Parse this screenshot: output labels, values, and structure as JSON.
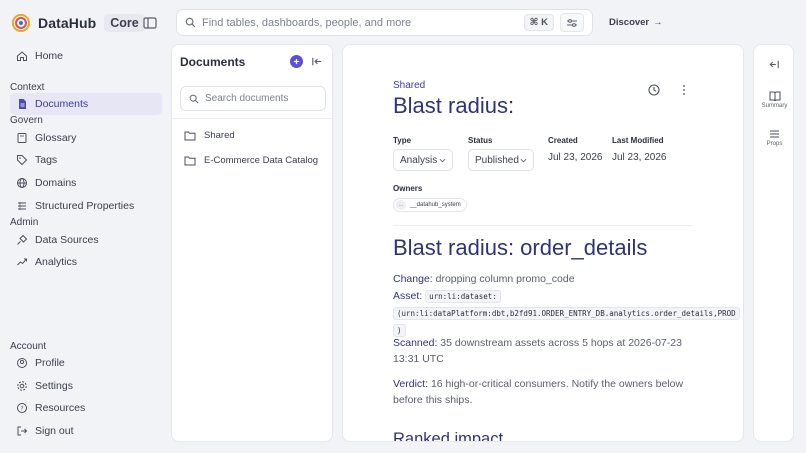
{
  "app": {
    "name": "DataHub",
    "badge": "Core"
  },
  "search": {
    "placeholder": "Find tables, dashboards, people, and more",
    "shortcut": "⌘ K"
  },
  "header": {
    "discover_label": "Discover"
  },
  "nav": {
    "home": "Home",
    "sections": {
      "context": "Context",
      "govern": "Govern",
      "admin": "Admin",
      "account": "Account"
    },
    "items": {
      "documents": "Documents",
      "glossary": "Glossary",
      "tags": "Tags",
      "domains": "Domains",
      "structured_properties": "Structured Properties",
      "data_sources": "Data Sources",
      "analytics": "Analytics",
      "profile": "Profile",
      "settings": "Settings",
      "resources": "Resources",
      "sign_out": "Sign out"
    }
  },
  "documents_panel": {
    "title": "Documents",
    "search_placeholder": "Search documents",
    "folders": [
      "Shared",
      "E-Commerce Data Catalog"
    ]
  },
  "document": {
    "breadcrumb": "Shared",
    "title": "Blast radius:",
    "type_label": "Type",
    "type_value": "Analysis",
    "status_label": "Status",
    "status_value": "Published",
    "created_label": "Created",
    "created_value": "Jul 23, 2026",
    "modified_label": "Last Modified",
    "modified_value": "Jul 23, 2026",
    "owners_label": "Owners",
    "owner_avatar": "...",
    "owner_name": "__datahub_system",
    "heading": "Blast radius: order_details",
    "change_label": "Change:",
    "change_text": " dropping column promo_code",
    "asset_label": "Asset:",
    "asset_code_1": "urn:li:dataset:",
    "asset_code_2": "(urn:li:dataPlatform:dbt,b2fd91.ORDER_ENTRY_DB.analytics.order_details,PROD",
    "asset_code_3": ")",
    "scanned_label": "Scanned:",
    "scanned_text": " 35 downstream assets across 5 hops at 2026-07-23 13:31 UTC",
    "verdict_label": "Verdict:",
    "verdict_text": " 16 high-or-critical consumers. Notify the owners below before this ships.",
    "subheading": "Ranked impact"
  },
  "rail": {
    "summary": "Summary",
    "props": "Props"
  },
  "colors": {
    "accent": "#5b4fd8",
    "title": "#2e3475",
    "active_bg": "#e7e6f5"
  }
}
